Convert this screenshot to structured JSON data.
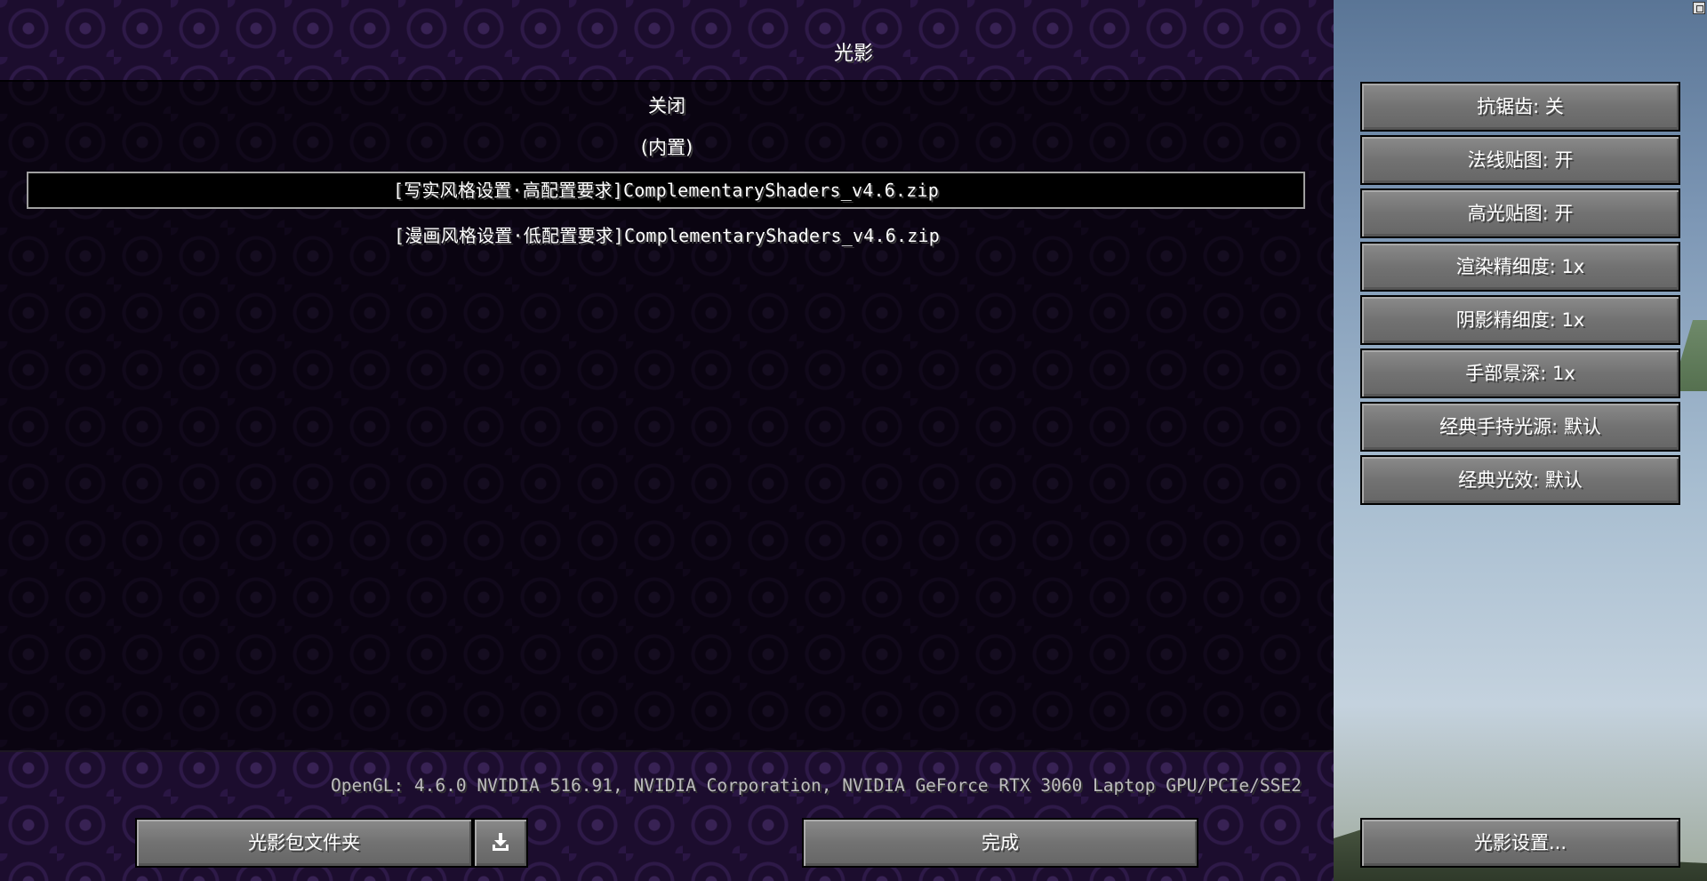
{
  "screen": {
    "title": "光影"
  },
  "shader_list": {
    "items": [
      {
        "label": "关闭"
      },
      {
        "label": "(内置)"
      },
      {
        "label": "[写实风格设置·高配置要求]ComplementaryShaders_v4.6.zip",
        "selected": true
      },
      {
        "label": "[漫画风格设置·低配置要求]ComplementaryShaders_v4.6.zip"
      }
    ]
  },
  "settings": {
    "buttons": [
      {
        "label": "抗锯齿: 关"
      },
      {
        "label": "法线贴图: 开"
      },
      {
        "label": "高光贴图: 开"
      },
      {
        "label": "渲染精细度: 1x"
      },
      {
        "label": "阴影精细度: 1x"
      },
      {
        "label": "手部景深: 1x"
      },
      {
        "label": "经典手持光源: 默认"
      },
      {
        "label": "经典光效: 默认"
      }
    ]
  },
  "footer": {
    "gpu_info": "OpenGL: 4.6.0 NVIDIA 516.91, NVIDIA Corporation, NVIDIA GeForce RTX 3060 Laptop GPU/PCIe/SSE2",
    "folder_button": "光影包文件夹",
    "download_icon": "download-icon",
    "done_button": "完成",
    "shader_settings_button": "光影设置..."
  },
  "colors": {
    "button_face": "#727272",
    "list_panel": "#000000",
    "background_purple": "#1c0d2e"
  }
}
